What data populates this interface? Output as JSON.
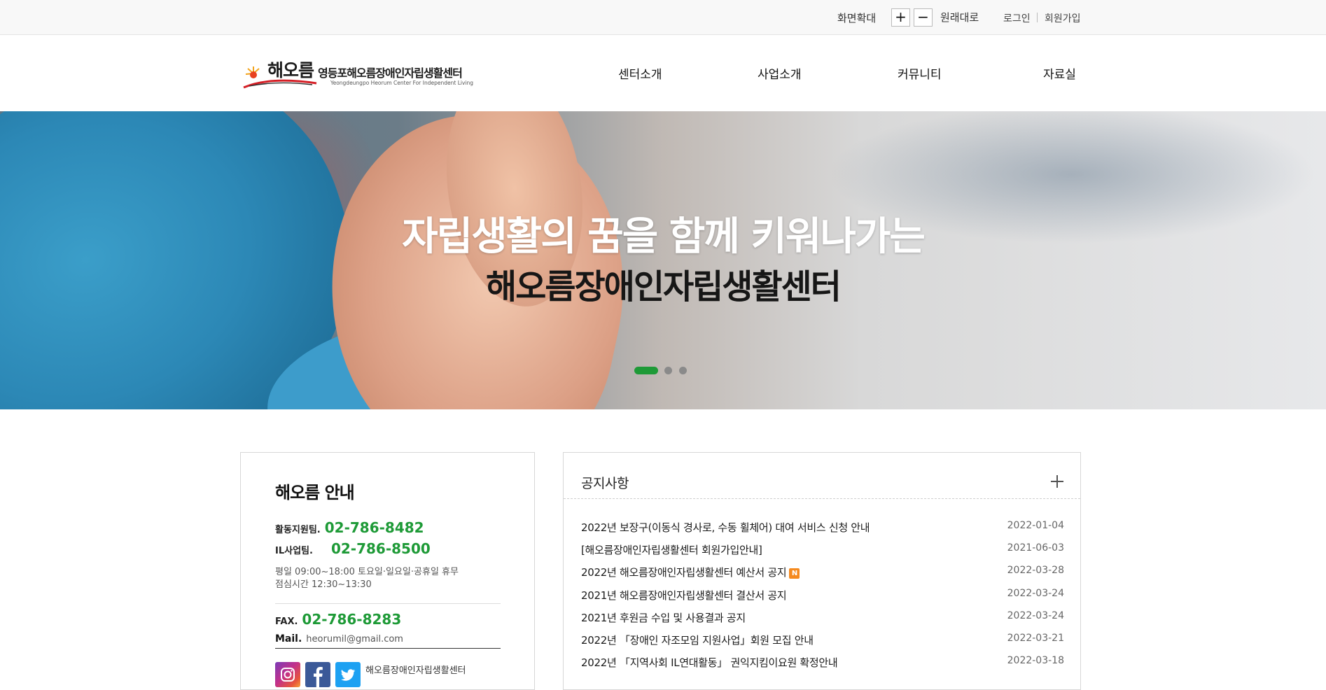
{
  "topbar": {
    "zoom_label": "화면확대",
    "zoom_in": "+",
    "zoom_out": "−",
    "reset": "원래대로",
    "login": "로그인",
    "join": "회원가입"
  },
  "header": {
    "logo_script": "해오름",
    "logo_name": "영등포해오름장애인자립생활센터",
    "logo_en": "Yeongdeungpo Heorum Center For Independent Living",
    "nav": [
      "센터소개",
      "사업소개",
      "커뮤니티",
      "자료실"
    ]
  },
  "hero": {
    "line1": "자립생활의 꿈을 함께 키워나가는",
    "line2": "해오름장애인자립생활센터",
    "slides": 3,
    "active_slide": 1
  },
  "info": {
    "title": "해오름 안내",
    "support_label": "활동지원팀.",
    "support_phone": "02-786-8482",
    "il_label": "IL사업팀.",
    "il_phone": "02-786-8500",
    "hours_line1": "평일 09:00~18:00 토요일·일요일·공휴일 휴무",
    "hours_line2": "점심시간 12:30~13:30",
    "fax_label": "FAX.",
    "fax": "02-786-8283",
    "mail_label": "Mail.",
    "mail": "heorumil@gmail.com",
    "sns_text": "해오름장애인자립생활센터",
    "colors": {
      "accent": "#1e9a37"
    }
  },
  "notice": {
    "title": "공지사항",
    "items": [
      {
        "title": "2022년 보장구(이동식 경사로, 수동 휠체어) 대여 서비스 신청 안내",
        "date": "2022-01-04",
        "new": false
      },
      {
        "title": "[해오름장애인자립생활센터 회원가입안내]",
        "date": "2021-06-03",
        "new": false
      },
      {
        "title": "2022년 해오름장애인자립생활센터 예산서 공지",
        "date": "2022-03-28",
        "new": true,
        "badge": "N"
      },
      {
        "title": "2021년 해오름장애인자립생활센터 결산서 공지",
        "date": "2022-03-24",
        "new": false
      },
      {
        "title": "2021년 후원금 수입 및 사용결과 공지",
        "date": "2022-03-24",
        "new": false
      },
      {
        "title": "2022년 「장애인 자조모임 지원사업」회원 모집 안내",
        "date": "2022-03-21",
        "new": false
      },
      {
        "title": "2022년 「지역사회 IL연대활동」 권익지킴이요원 확정안내",
        "date": "2022-03-18",
        "new": false
      }
    ]
  }
}
